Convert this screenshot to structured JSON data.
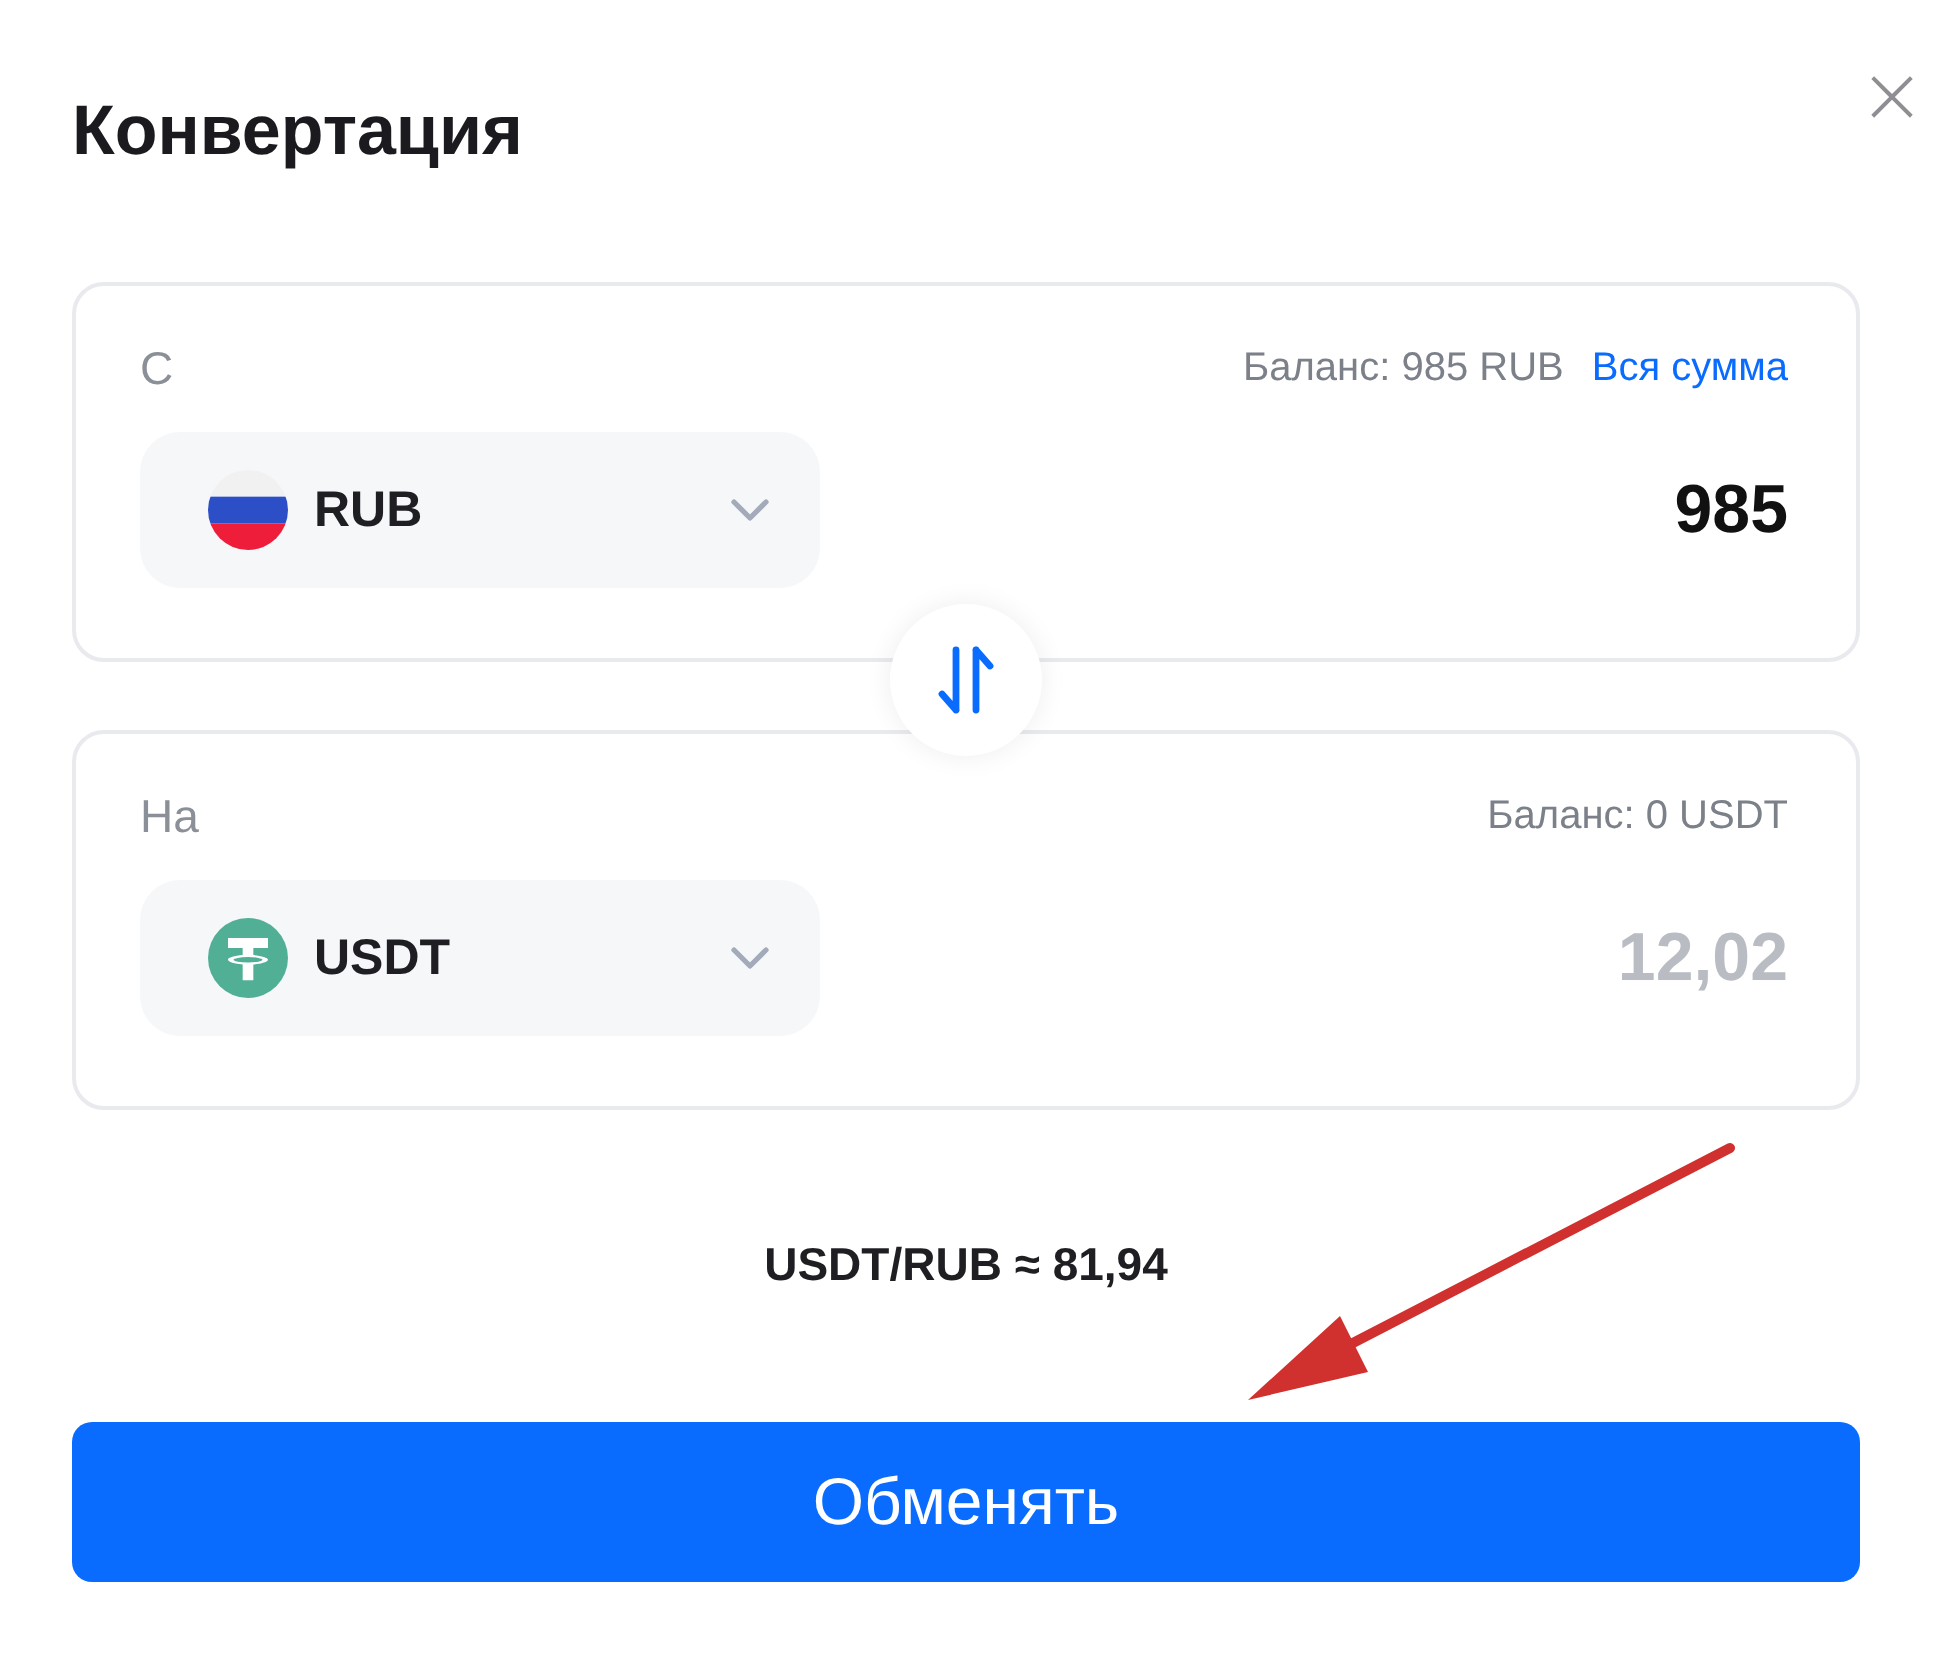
{
  "dialog": {
    "title": "Конвертация",
    "close_label": "×"
  },
  "from": {
    "label": "С",
    "balance": "Баланс: 985 RUB",
    "max_link": "Вся сумма",
    "currency": {
      "code": "RUB",
      "kind": "ru"
    },
    "amount": {
      "value": "985",
      "readonly": false
    }
  },
  "to": {
    "label": "На",
    "balance": "Баланс: 0 USDT",
    "currency": {
      "code": "USDT",
      "kind": "tether"
    },
    "amount": {
      "value": "12,02",
      "readonly": true
    }
  },
  "rate": "USDT/RUB ≈ 81,94",
  "submit": "Обменять"
}
